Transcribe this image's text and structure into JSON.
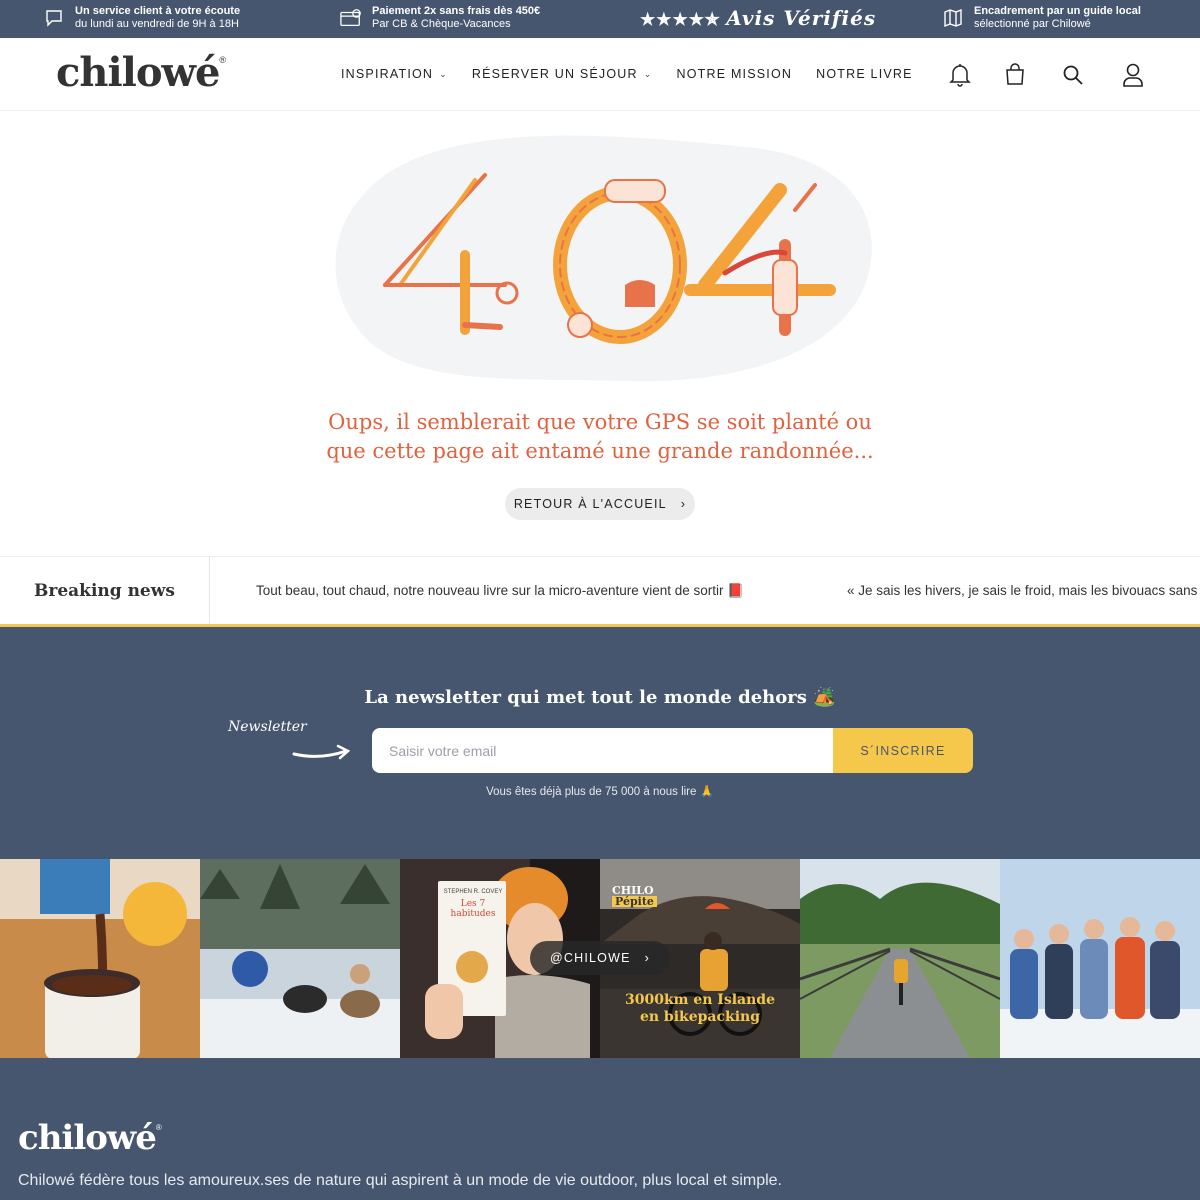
{
  "topbar": {
    "service_title": "Un service client à votre écoute",
    "service_sub": "du lundi au vendredi de 9H à 18H",
    "payment_title": "Paiement  2x sans frais dès 450€",
    "payment_sub": "Par CB & Chèque-Vacances",
    "reviews_stars": "★★★★✯",
    "reviews_label": "Avis Vérifiés",
    "guide_title": "Encadrement par un guide local",
    "guide_sub": "sélectionné par Chilowé"
  },
  "header": {
    "logo": "chilowé",
    "logo_mark": "®",
    "nav": [
      {
        "label": "INSPIRATION",
        "chevron": "⌄"
      },
      {
        "label": "RÉSERVER UN SÉJOUR",
        "chevron": "⌄"
      },
      {
        "label": "NOTRE MISSION"
      },
      {
        "label": "NOTRE LIVRE"
      }
    ],
    "icons": [
      "bell-icon",
      "bag-icon",
      "search-icon",
      "user-icon"
    ]
  },
  "error": {
    "code": "404",
    "message_line1": "Oups, il semblerait que votre GPS se soit planté ou",
    "message_line2": "que cette page ait entamé une grande randonnée...",
    "button_label": "RETOUR À L'ACCUEIL",
    "button_chevron": "›"
  },
  "news": {
    "title": "Breaking news",
    "items": [
      "Tout beau, tout chaud, notre nouveau livre sur la micro-aventure vient de sortir 📕",
      "« Je sais les hivers, je sais le froid, mais les bivouacs sans t"
    ]
  },
  "newsletter": {
    "title": "La newsletter qui met tout le monde dehors 🏕️",
    "handwritten": "Newsletter",
    "placeholder": "Saisir votre email",
    "button_label": "S´INSCRIRE",
    "subtext": "Vous êtes déjà plus de 75 000 à nous lire 🙏"
  },
  "instagram": {
    "handle": "@CHILOWE",
    "chevron": "›",
    "tiles": [
      {
        "name": "hot-chocolate"
      },
      {
        "name": "sled-dogs"
      },
      {
        "name": "book-selfie",
        "book_author": "STEPHEN R. COVEY",
        "book_title": "Les 7 habitudes"
      },
      {
        "name": "iceland-bikepacking",
        "badge_line1": "CHILO",
        "badge_line2": "Pépite",
        "caption_line1": "3000km en Islande",
        "caption_line2": "en bikepacking"
      },
      {
        "name": "bridge-cycling"
      },
      {
        "name": "snow-group"
      }
    ]
  },
  "footer": {
    "logo": "chilowé",
    "logo_mark": "®",
    "tagline": "Chilowé fédère tous les amoureux.ses de nature qui aspirent à un mode de vie outdoor, plus local et simple."
  },
  "colors": {
    "navy": "#46566f",
    "accent_orange": "#e0623f",
    "yellow": "#f5c84c"
  }
}
